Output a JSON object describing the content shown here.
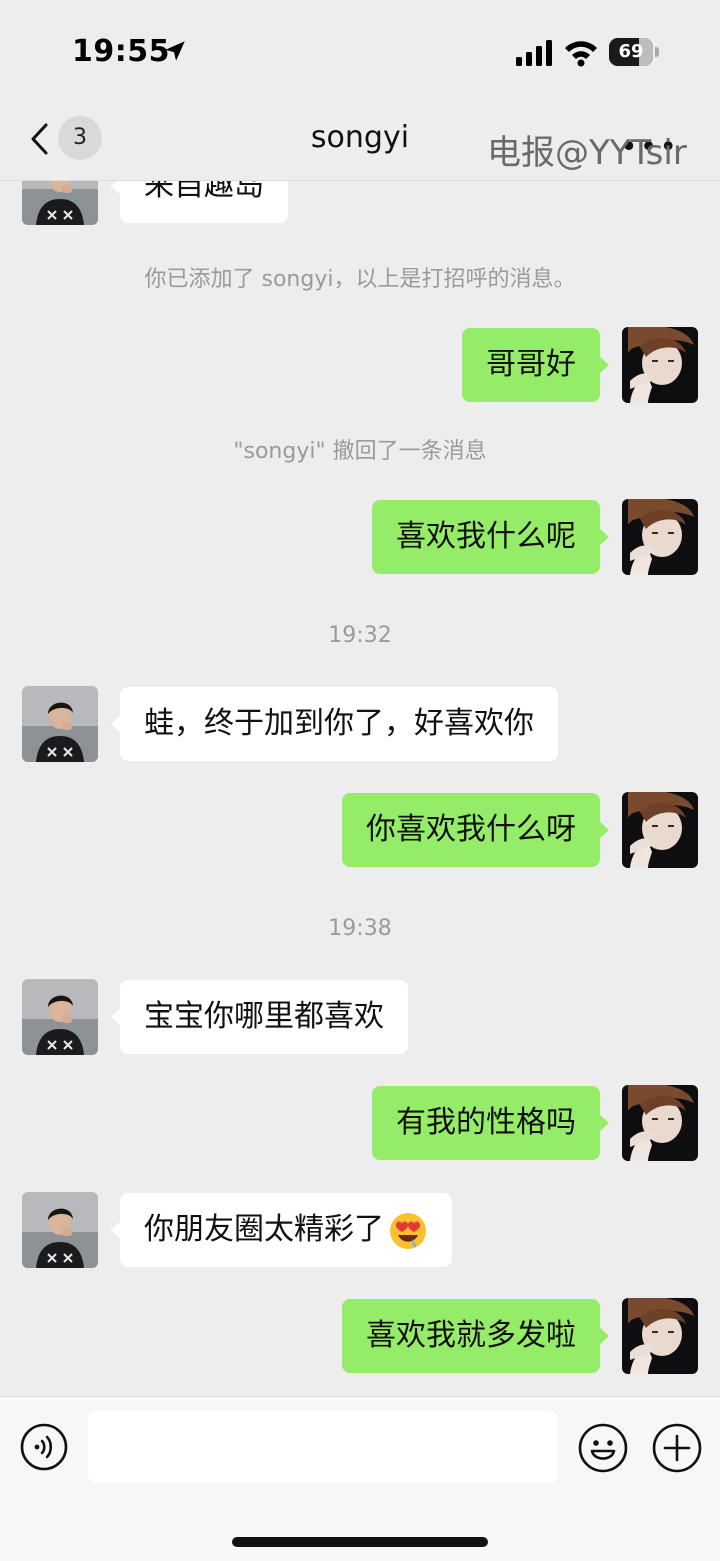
{
  "status_bar": {
    "time": "19:55",
    "battery": "69",
    "battery_level": 0.69
  },
  "nav": {
    "unread_count": "3",
    "title": "songyi",
    "more": "•••"
  },
  "watermark": "电报@YYTsir",
  "messages": [
    {
      "kind": "in",
      "text": "来自趣岛"
    },
    {
      "kind": "system",
      "text": "你已添加了 songyi，以上是打招呼的消息。"
    },
    {
      "kind": "out",
      "text": "哥哥好"
    },
    {
      "kind": "system",
      "text": "\"songyi\" 撤回了一条消息"
    },
    {
      "kind": "out",
      "text": "喜欢我什么呢"
    },
    {
      "kind": "timestamp",
      "text": "19:32"
    },
    {
      "kind": "in",
      "text": "蛙，终于加到你了，好喜欢你"
    },
    {
      "kind": "out",
      "text": "你喜欢我什么呀"
    },
    {
      "kind": "timestamp",
      "text": "19:38"
    },
    {
      "kind": "in",
      "text": "宝宝你哪里都喜欢"
    },
    {
      "kind": "out",
      "text": "有我的性格吗"
    },
    {
      "kind": "in",
      "text": "你朋友圈太精彩了",
      "emoji": "heart-eyes-drooling-emoji"
    },
    {
      "kind": "out",
      "text": "喜欢我就多发啦"
    }
  ],
  "input_bar": {
    "placeholder": ""
  },
  "icons": {
    "back": "chevron-left-icon",
    "voice": "voice-icon",
    "emoji": "smiley-icon",
    "plus": "plus-icon"
  },
  "colors": {
    "outgoing_bubble": "#95ec69",
    "incoming_bubble": "#ffffff",
    "background": "#ededed"
  }
}
